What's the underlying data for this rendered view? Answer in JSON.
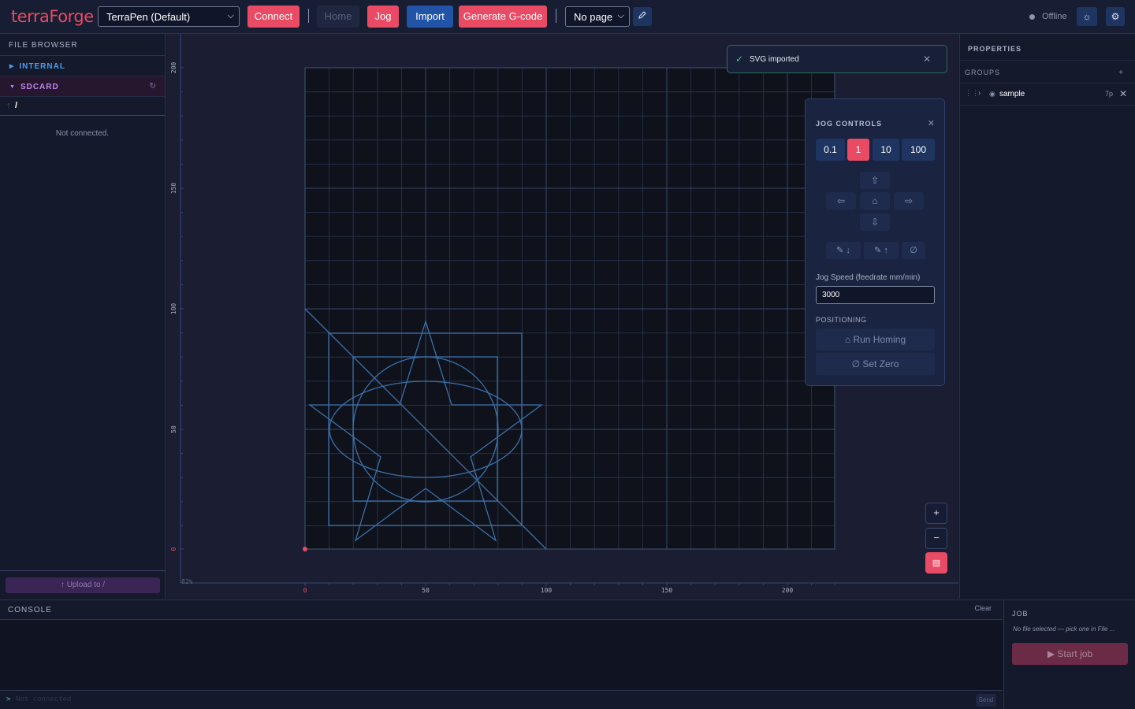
{
  "topbar": {
    "logo": "terraForge",
    "machine_select": "TerraPen (Default)",
    "connect_label": "Connect",
    "home_label": "Home",
    "jog_label": "Jog",
    "import_label": "Import",
    "generate_label": "Generate G-code",
    "page_select": "No page",
    "status": "Offline",
    "colors": {
      "accent": "#e94a64",
      "primary": "#2154a6",
      "background": "#141a2c"
    }
  },
  "file_browser": {
    "title": "FILE BROWSER",
    "internal": "INTERNAL",
    "sdcard": "SDCARD",
    "path": "/",
    "message": "Not connected.",
    "upload_label": "↑ Upload to /"
  },
  "canvas": {
    "axis_labels_x": [
      "0",
      "50",
      "100",
      "150",
      "200"
    ],
    "axis_labels_y": [
      "0",
      "50",
      "100",
      "150",
      "200"
    ],
    "zoom_percent": "82%"
  },
  "toast": {
    "message": "SVG imported"
  },
  "jog_controls": {
    "title": "JOG CONTROLS",
    "steps": [
      "0.1",
      "1",
      "10",
      "100"
    ],
    "active_step": "1",
    "speed_label": "Jog Speed (feedrate mm/min)",
    "speed_value": "3000",
    "positioning_label": "POSITIONING",
    "run_homing": "Run Homing",
    "set_zero": "Set Zero"
  },
  "zoom_controls": {
    "zoom_in": "+",
    "zoom_out": "−"
  },
  "properties": {
    "title": "PROPERTIES",
    "groups_label": "GROUPS",
    "add": "+",
    "group_name": "sample",
    "group_count": "7p"
  },
  "console": {
    "title": "CONSOLE",
    "clear_label": "Clear",
    "prompt": ">",
    "placeholder": "Not connected",
    "send_label": "Send"
  },
  "job": {
    "title": "JOB",
    "message": "No file selected — pick one in File ...",
    "start_label": "▶ Start job"
  }
}
